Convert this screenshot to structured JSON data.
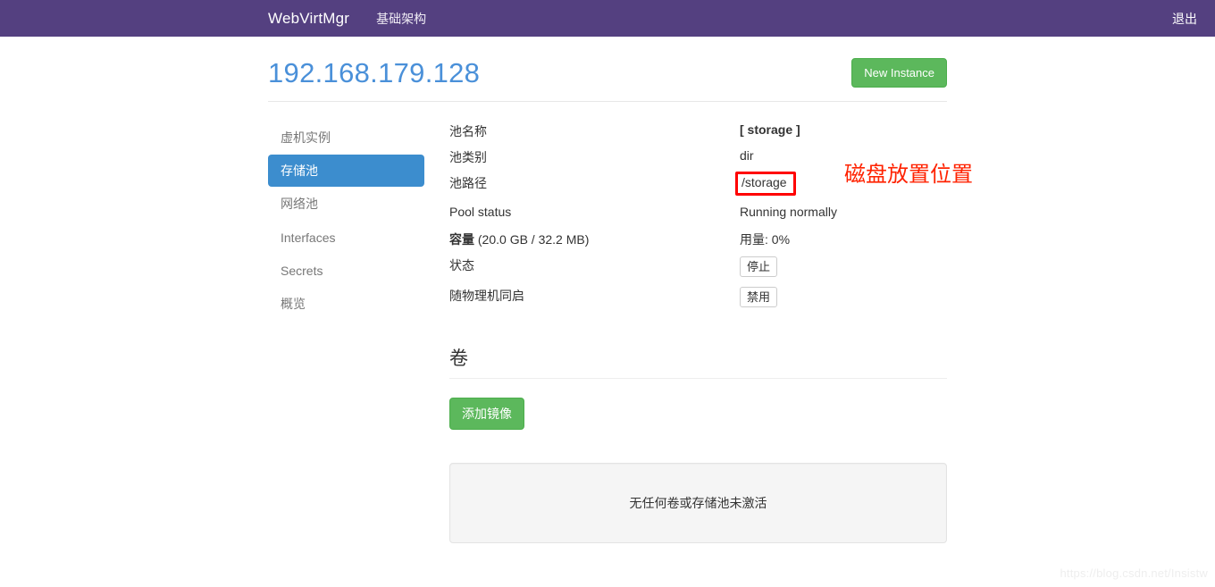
{
  "navbar": {
    "brand": "WebVirtMgr",
    "infrastructure_link": "基础架构",
    "logout_link": "退出"
  },
  "page": {
    "title": "192.168.179.128",
    "new_instance_button": "New Instance"
  },
  "sidebar": {
    "items": [
      {
        "label": "虚机实例",
        "active": false
      },
      {
        "label": "存储池",
        "active": true
      },
      {
        "label": "网络池",
        "active": false
      },
      {
        "label": "Interfaces",
        "active": false
      },
      {
        "label": "Secrets",
        "active": false
      },
      {
        "label": "概览",
        "active": false
      }
    ]
  },
  "pool_details": {
    "name_label": "池名称",
    "name_value": "[ storage ]",
    "type_label": "池类别",
    "type_value": "dir",
    "path_label": "池路径",
    "path_value": "/storage",
    "status_label": "Pool status",
    "status_value": "Running normally",
    "capacity_label": "容量",
    "capacity_detail": "(20.0 GB / 32.2 MB)",
    "usage_value": "用量: 0%",
    "state_label": "状态",
    "state_button": "停止",
    "autostart_label": "随物理机同启",
    "autostart_button": "禁用"
  },
  "annotation": {
    "text": "磁盘放置位置",
    "color": "#ff2200"
  },
  "volumes": {
    "title": "卷",
    "add_image_button": "添加镜像",
    "empty_message": "无任何卷或存储池未激活"
  },
  "watermark": {
    "text": "https://blog.csdn.net/Insistw"
  },
  "colors": {
    "navbar": "#544080",
    "title_blue": "#4a90d9",
    "active_pill": "#3c8dce",
    "success_green": "#5cb85c",
    "annotation_red": "#ff0000"
  }
}
